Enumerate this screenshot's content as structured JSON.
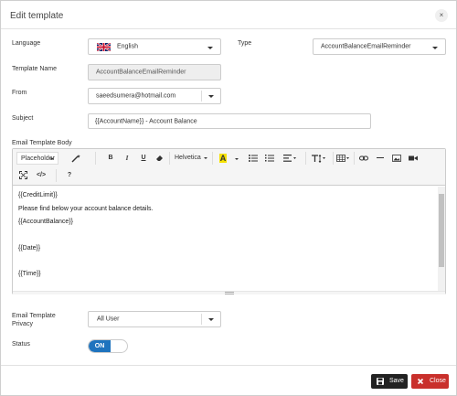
{
  "dialog": {
    "title": "Edit template",
    "close_icon": "×"
  },
  "form": {
    "language_label": "Language",
    "language_value": "English",
    "type_label": "Type",
    "type_value": "AccountBalanceEmailReminder",
    "template_name_label": "Template Name",
    "template_name_value": "AccountBalanceEmailReminder",
    "from_label": "From",
    "from_value": "saeedsumera@hotmail.com",
    "subject_label": "Subject",
    "subject_value": "{{AccountName}} - Account Balance",
    "body_label": "Email Template Body",
    "privacy_label_1": "Email Template",
    "privacy_label_2": "Privacy",
    "privacy_value": "All User",
    "status_label": "Status",
    "status_value": "ON"
  },
  "toolbar": {
    "placeholder": "Placeholder",
    "bold": "B",
    "italic": "I",
    "underline": "U",
    "font": "Helvetica",
    "font_color": "A",
    "code": "</>",
    "help": "?"
  },
  "body_lines": [
    "{{CreditLimit}}",
    "Please find below your account balance details.",
    "{{AccountBalance}}",
    "{{Date}}",
    "{{Time}}"
  ],
  "footer": {
    "save_label": "Save",
    "close_label": "Close"
  },
  "colors": {
    "accent": "#1e73be",
    "save": "#222222",
    "close": "#c9302c",
    "highlight": "#f5e100"
  }
}
